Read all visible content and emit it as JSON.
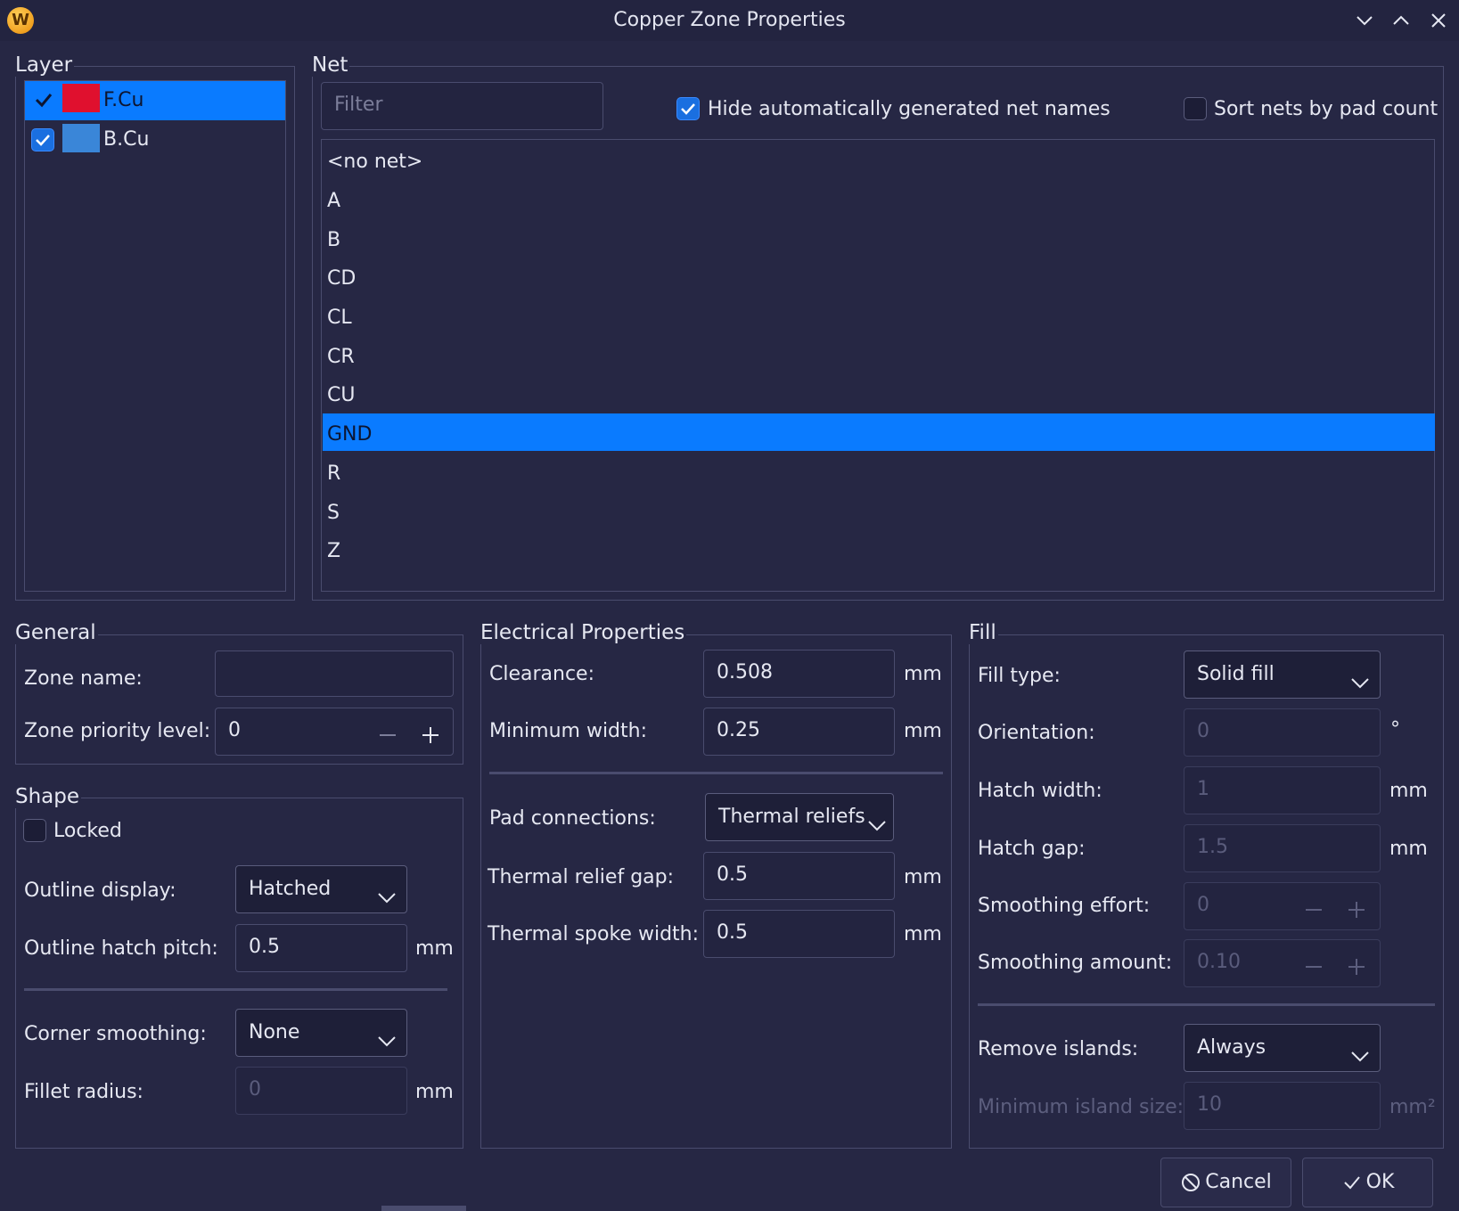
{
  "window": {
    "title": "Copper Zone Properties",
    "app_icon_letter": "W",
    "controls": [
      "minimize-icon",
      "maximize-icon",
      "close-icon"
    ]
  },
  "layer": {
    "title": "Layer",
    "items": [
      {
        "label": "F.Cu",
        "checked": true,
        "color": "#e0102e",
        "selected": true
      },
      {
        "label": "B.Cu",
        "checked": true,
        "color": "#3a86d8",
        "selected": false
      }
    ]
  },
  "net": {
    "title": "Net",
    "filter_placeholder": "Filter",
    "hide_auto_label": "Hide automatically generated net names",
    "hide_auto_checked": true,
    "sort_label": "Sort nets by pad count",
    "sort_checked": false,
    "items": [
      "<no net>",
      "A",
      "B",
      "CD",
      "CL",
      "CR",
      "CU",
      "GND",
      "R",
      "S",
      "Z"
    ],
    "selected": "GND"
  },
  "general": {
    "title": "General",
    "zone_name_label": "Zone name:",
    "zone_name_value": "",
    "priority_label": "Zone priority level:",
    "priority_value": "0"
  },
  "shape": {
    "title": "Shape",
    "locked_label": "Locked",
    "locked_checked": false,
    "outline_display_label": "Outline display:",
    "outline_display_value": "Hatched",
    "outline_pitch_label": "Outline hatch pitch:",
    "outline_pitch_value": "0.5",
    "outline_pitch_unit": "mm",
    "corner_label": "Corner smoothing:",
    "corner_value": "None",
    "fillet_label": "Fillet radius:",
    "fillet_value": "0",
    "fillet_unit": "mm"
  },
  "electrical": {
    "title": "Electrical Properties",
    "clearance_label": "Clearance:",
    "clearance_value": "0.508",
    "clearance_unit": "mm",
    "minwidth_label": "Minimum width:",
    "minwidth_value": "0.25",
    "minwidth_unit": "mm",
    "pad_label": "Pad connections:",
    "pad_value": "Thermal reliefs",
    "gap_label": "Thermal relief gap:",
    "gap_value": "0.5",
    "gap_unit": "mm",
    "spoke_label": "Thermal spoke width:",
    "spoke_value": "0.5",
    "spoke_unit": "mm"
  },
  "fill": {
    "title": "Fill",
    "type_label": "Fill type:",
    "type_value": "Solid fill",
    "orientation_label": "Orientation:",
    "orientation_value": "0",
    "orientation_unit": "°",
    "hatch_width_label": "Hatch width:",
    "hatch_width_value": "1",
    "hatch_width_unit": "mm",
    "hatch_gap_label": "Hatch gap:",
    "hatch_gap_value": "1.5",
    "hatch_gap_unit": "mm",
    "smoothing_effort_label": "Smoothing effort:",
    "smoothing_effort_value": "0",
    "smoothing_amount_label": "Smoothing amount:",
    "smoothing_amount_value": "0.10",
    "remove_islands_label": "Remove islands:",
    "remove_islands_value": "Always",
    "min_island_label": "Minimum island size:",
    "min_island_value": "10",
    "min_island_unit": "mm²"
  },
  "buttons": {
    "cancel": "Cancel",
    "ok": "OK"
  }
}
